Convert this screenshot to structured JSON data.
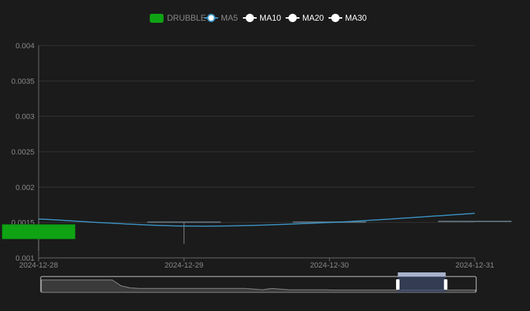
{
  "chart_data": {
    "type": "candlestick",
    "categories": [
      "2024-12-28",
      "2024-12-29",
      "2024-12-30",
      "2024-12-31"
    ],
    "ylim": [
      0.001,
      0.004
    ],
    "y_ticks": [
      "0.004",
      "0.0035",
      "0.003",
      "0.0025",
      "0.002",
      "0.0015",
      "0.001"
    ],
    "grid": true,
    "legend_position": "top-center",
    "series": [
      {
        "name": "DRUBBLE",
        "type": "candlestick",
        "color": "#0fa314",
        "values": [
          {
            "open": 0.00147,
            "close": 0.00127,
            "low": 0.0011,
            "high": 0.00156
          },
          {
            "open": 0.00151,
            "close": 0.00151,
            "low": 0.0012,
            "high": 0.00151
          },
          {
            "open": 0.00151,
            "close": 0.00151,
            "low": 0.00151,
            "high": 0.00151
          },
          {
            "open": 0.00152,
            "close": 0.00152,
            "low": 0.00152,
            "high": 0.00152
          }
        ]
      },
      {
        "name": "MA5",
        "type": "line",
        "color": "#3d96c8",
        "values": [
          0.00155,
          0.00145,
          0.0015,
          0.00163
        ]
      },
      {
        "name": "MA10",
        "type": "line",
        "color": "#ffffff",
        "values": []
      },
      {
        "name": "MA20",
        "type": "line",
        "color": "#ffffff",
        "values": []
      },
      {
        "name": "MA30",
        "type": "line",
        "color": "#ffffff",
        "values": []
      }
    ]
  },
  "legend": {
    "drubble": "DRUBBLE",
    "ma5": "MA5",
    "ma10": "MA10",
    "ma20": "MA20",
    "ma30": "MA30"
  },
  "zoom": {
    "start_fraction": 0.82,
    "end_fraction": 0.93
  }
}
